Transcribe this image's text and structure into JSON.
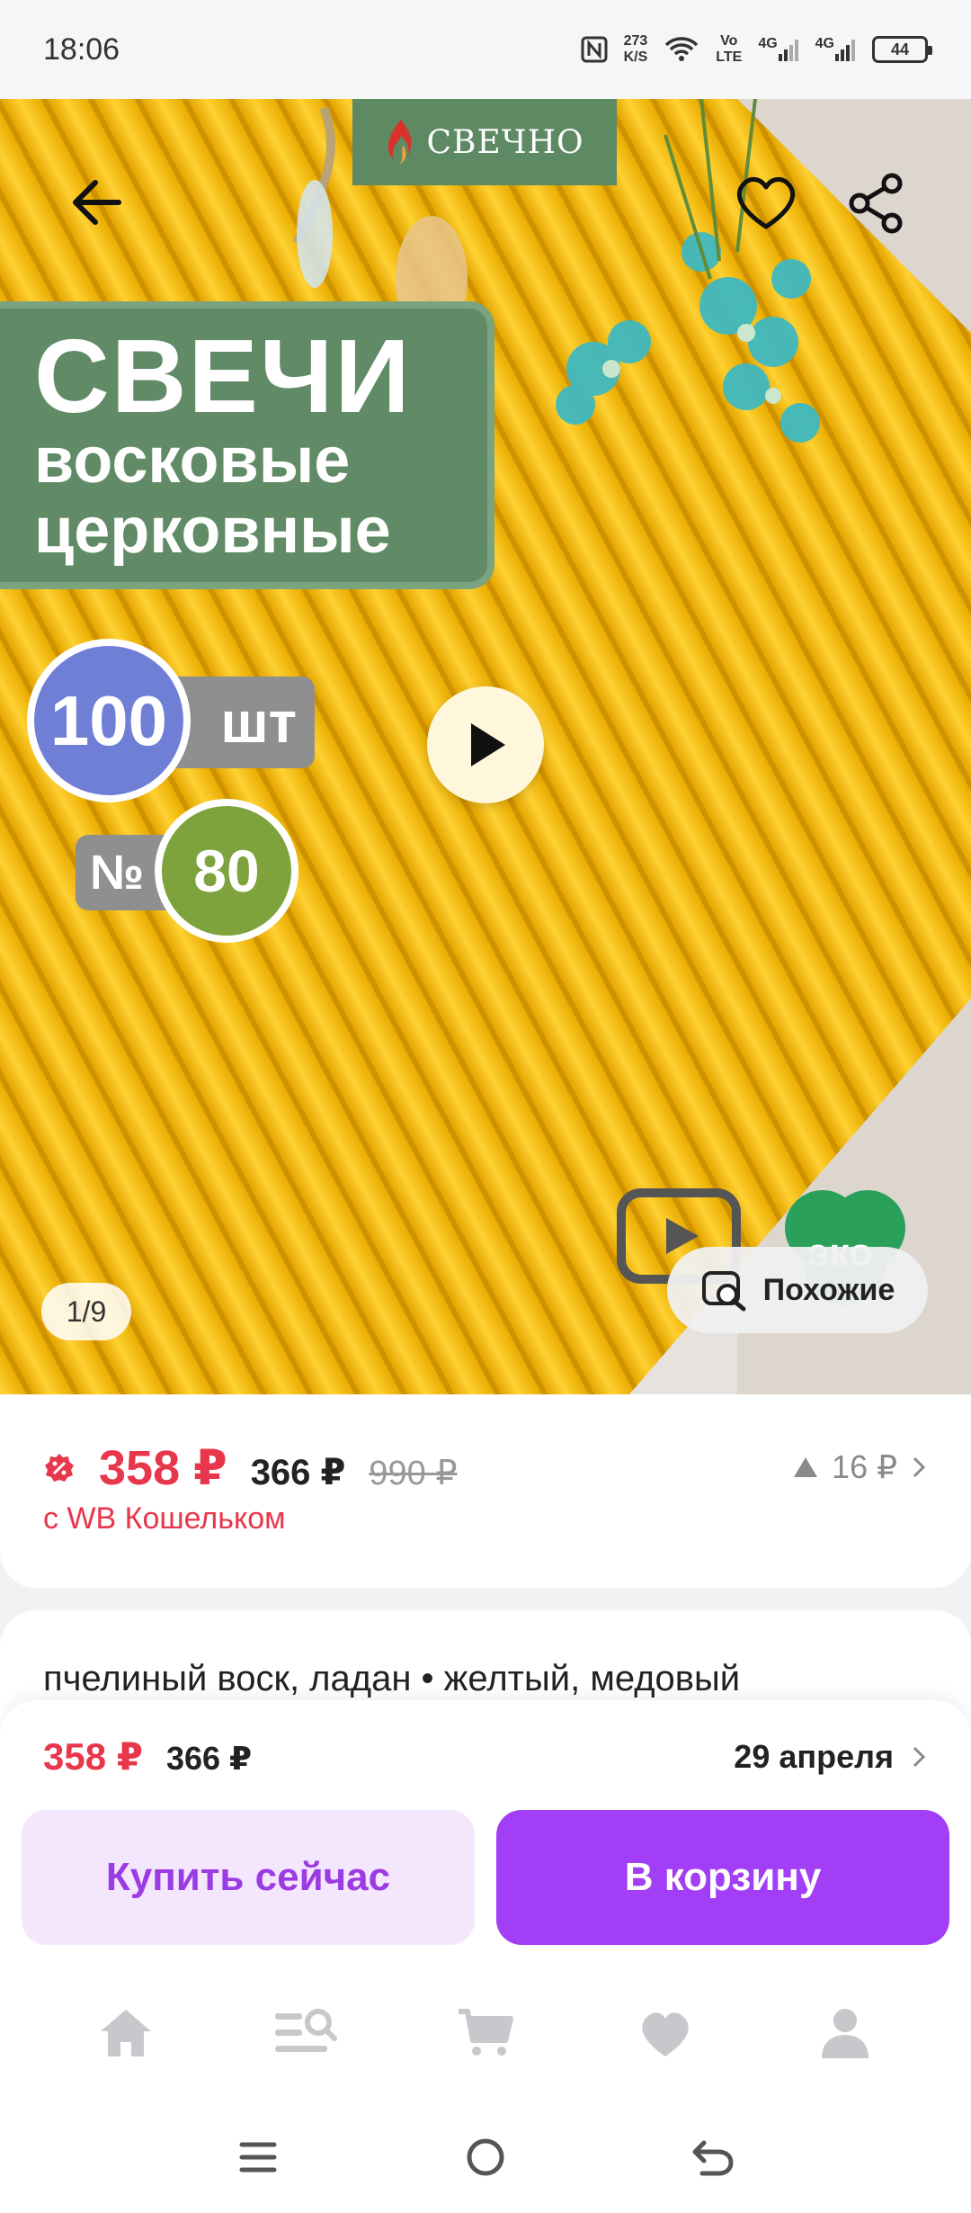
{
  "status_bar": {
    "time": "18:06",
    "net_speed_value": "273",
    "net_speed_unit": "K/S",
    "volte_top": "Vo",
    "volte_bottom": "LTE",
    "signal1": "4G",
    "signal2": "4G",
    "battery": "44"
  },
  "hero": {
    "brand": "СВЕЧНО",
    "title_line1": "СВЕЧИ",
    "title_line2": "восковые",
    "title_line3": "церковные",
    "quantity_value": "100",
    "quantity_unit": "шт",
    "number_label": "№",
    "number_value": "80",
    "eco_label": "эко",
    "counter": "1/9",
    "similar_label": "Похожие"
  },
  "price": {
    "current": "358 ₽",
    "base": "366 ₽",
    "old": "990 ₽",
    "wallet_label": "с WB Кошельком",
    "delta": "16 ₽"
  },
  "description": {
    "text": "пчелиный воск, ладан • желтый, медовый"
  },
  "buy_bar": {
    "price_current": "358 ₽",
    "price_base": "366 ₽",
    "delivery_date": "29 апреля",
    "buy_now_label": "Купить сейчас",
    "add_to_cart_label": "В корзину"
  },
  "colors": {
    "accent_purple": "#a23ef5",
    "price_red": "#e8364b",
    "brand_green": "#5d8a63"
  },
  "icons": {
    "nav": [
      "home-icon",
      "catalog-search-icon",
      "cart-icon",
      "favorites-icon",
      "profile-icon"
    ],
    "system": [
      "menu-icon",
      "home-circle-icon",
      "back-icon"
    ]
  }
}
